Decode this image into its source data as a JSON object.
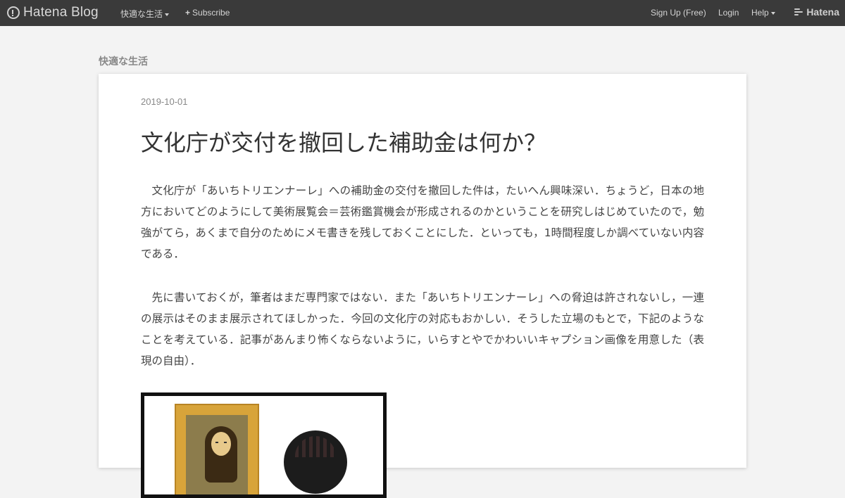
{
  "topbar": {
    "brand": "Hatena Blog",
    "blog_menu": "快適な生活",
    "subscribe": "Subscribe",
    "signup": "Sign Up (Free)",
    "login": "Login",
    "help": "Help",
    "hatena": "Hatena"
  },
  "blog": {
    "title": "快適な生活"
  },
  "entry": {
    "date": "2019-10-01",
    "title": "文化庁が交付を撤回した補助金は何か？",
    "paragraphs": [
      "文化庁が「あいちトリエンナーレ」への補助金の交付を撤回した件は，たいへん興味深い．ちょうど，日本の地方においてどのようにして美術展覧会＝芸術鑑賞機会が形成されるのかということを研究しはじめていたので，勉強がてら，あくまで自分のためにメモ書きを残しておくことにした．といっても，1時間程度しか調べていない内容である．",
      "先に書いておくが，筆者はまだ専門家ではない．また「あいちトリエンナーレ」への脅迫は許されないし，一連の展示はそのまま展示されてほしかった．今回の文化庁の対応もおかしい．そうした立場のもとで，下記のようなことを考えている．記事があんまり怖くならないように，いらすとやでかわいいキャプション画像を用意した（表現の自由）．"
    ]
  },
  "colors": {
    "topbar": "#3a3a3a",
    "page_bg": "#f3f3f3",
    "card_bg": "#ffffff"
  }
}
